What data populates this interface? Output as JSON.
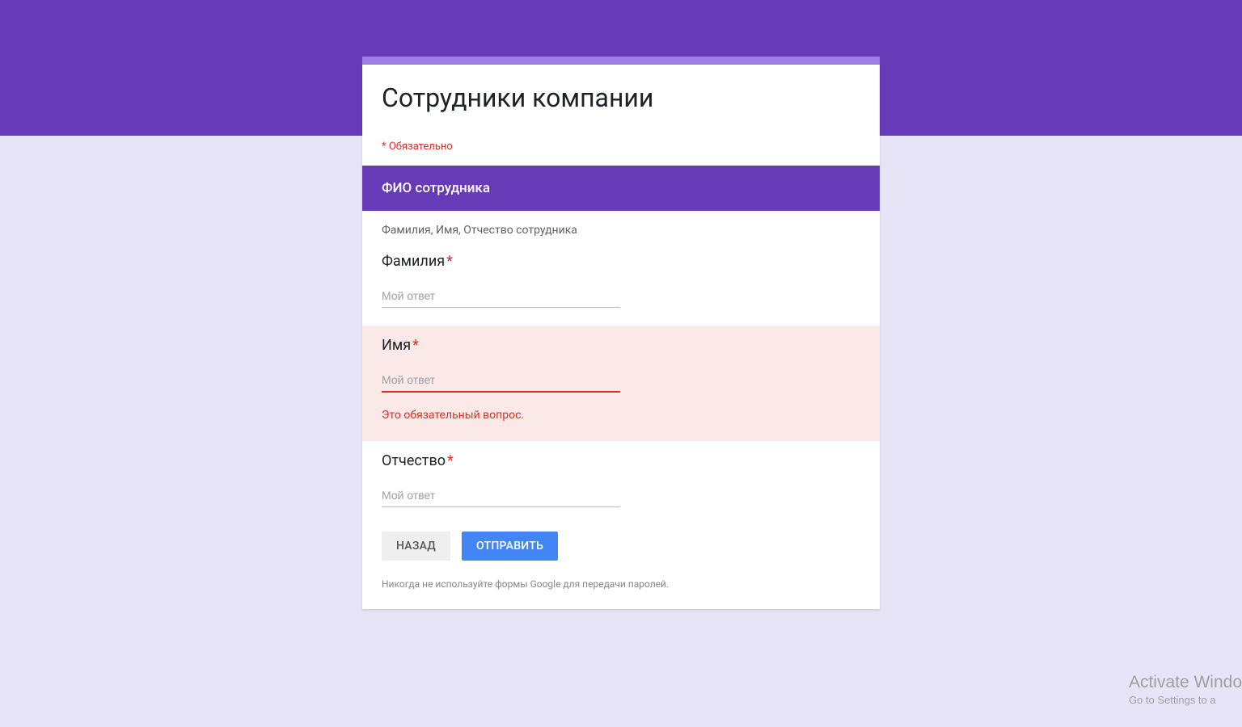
{
  "colors": {
    "accent": "#673ab7",
    "accent_light": "#9d7ee0",
    "error": "#d93025",
    "error_bg": "#fbe9e7",
    "submit": "#4285f4"
  },
  "header": {
    "title": "Сотрудники компании",
    "required_note": "* Обязательно"
  },
  "section": {
    "title": "ФИО сотрудника",
    "description": "Фамилия, Имя, Отчество сотрудника"
  },
  "questions": [
    {
      "label": "Фамилия",
      "required": true,
      "placeholder": "Мой ответ",
      "value": "",
      "error": false
    },
    {
      "label": "Имя",
      "required": true,
      "placeholder": "Мой ответ",
      "value": "",
      "error": true,
      "error_text": "Это обязательный вопрос."
    },
    {
      "label": "Отчество",
      "required": true,
      "placeholder": "Мой ответ",
      "value": "",
      "error": false
    }
  ],
  "actions": {
    "back": "НАЗАД",
    "submit": "ОТПРАВИТЬ"
  },
  "disclaimer": "Никогда не используйте формы Google для передачи паролей.",
  "watermark": {
    "line1": "Activate Windo",
    "line2": "Go to Settings to a"
  }
}
